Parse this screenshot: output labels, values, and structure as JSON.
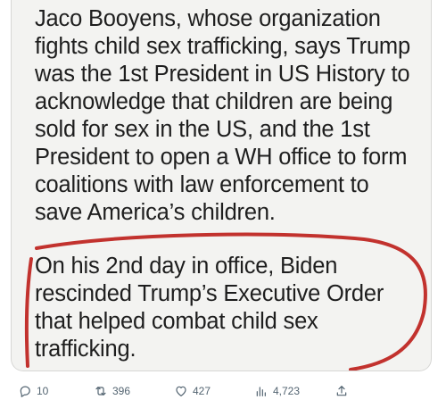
{
  "post": {
    "image_text": {
      "paragraph_1": [
        "Jaco Booyens, whose organization",
        "fights child sex trafficking, says Trump",
        "was the 1st President in US History to",
        "acknowledge that children are being",
        "sold for sex in the US, and the 1st",
        "President to open a WH office to form",
        "coalitions with law enforcement to",
        "save America’s children."
      ],
      "paragraph_2": [
        "On his 2nd day in office, Biden",
        "rescinded Trump’s Executive Order",
        "that helped combat child sex",
        "trafficking."
      ]
    },
    "highlight_color": "#c2322e"
  },
  "actions": {
    "reply": {
      "icon": "reply-icon",
      "count": "10"
    },
    "retweet": {
      "icon": "retweet-icon",
      "count": "396"
    },
    "like": {
      "icon": "heart-icon",
      "count": "427"
    },
    "views": {
      "icon": "views-icon",
      "count": "4,723"
    },
    "share": {
      "icon": "share-icon",
      "count": ""
    }
  },
  "colors": {
    "action_gray": "#536471",
    "text": "#1e1e1e",
    "card_bg": "#f3f3f1"
  }
}
